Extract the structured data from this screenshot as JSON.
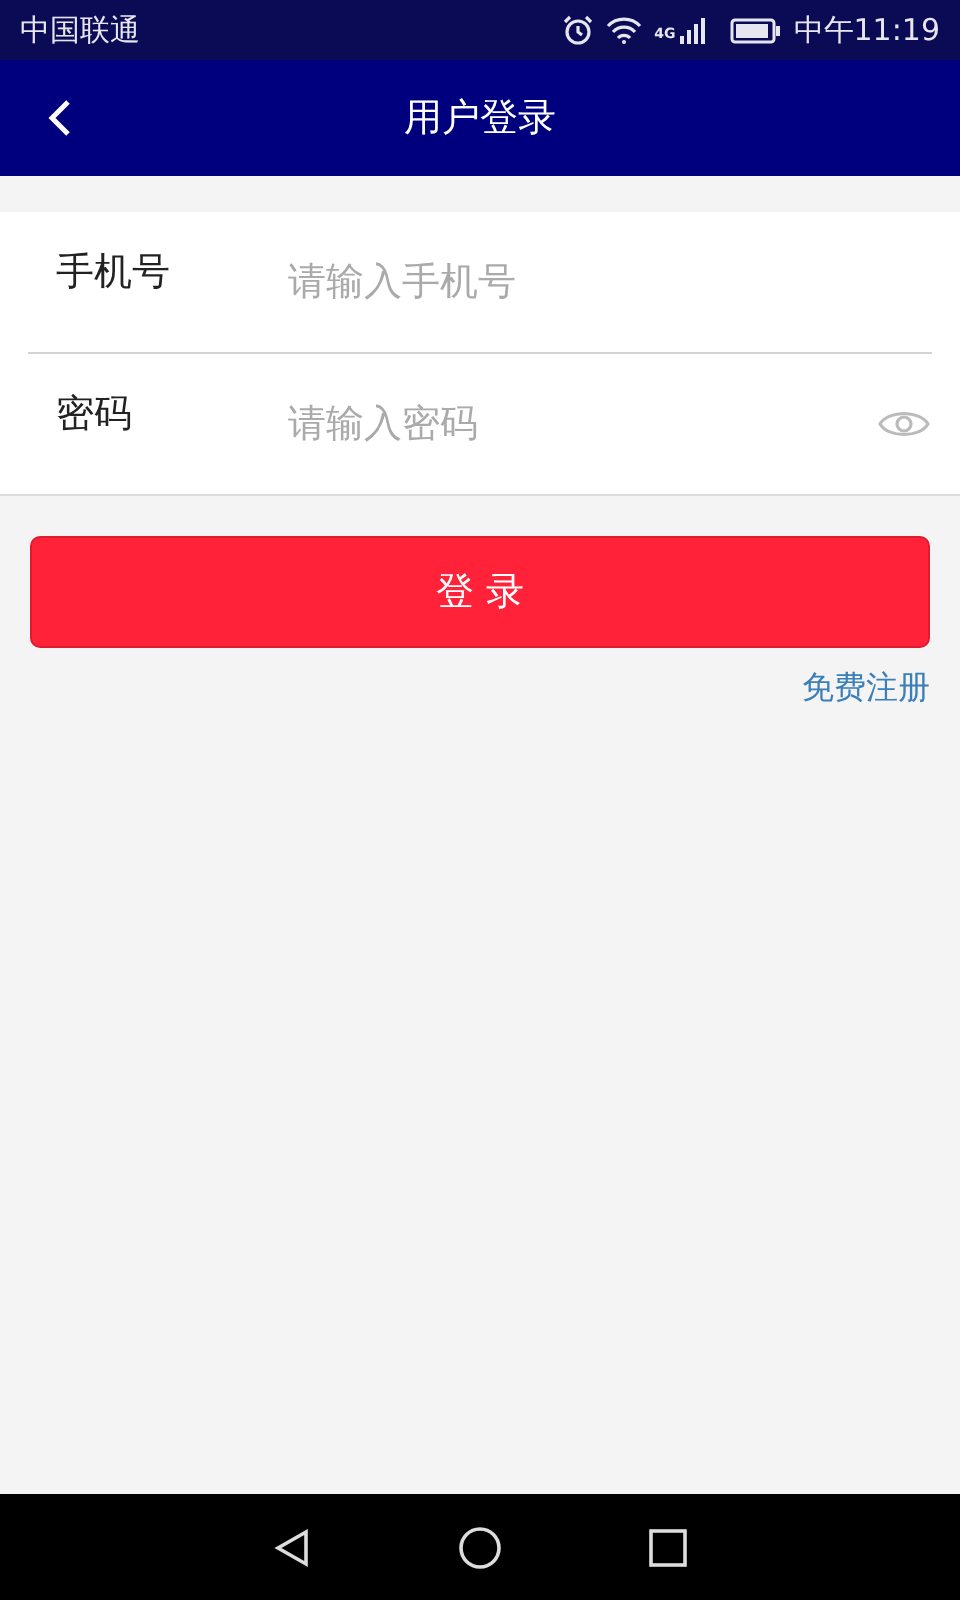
{
  "status_bar": {
    "carrier": "中国联通",
    "network": "4G",
    "time": "中午11:19"
  },
  "header": {
    "title": "用户登录"
  },
  "form": {
    "fields": [
      {
        "label": "手机号",
        "placeholder": "请输入手机号",
        "kind": "text"
      },
      {
        "label": "密码",
        "placeholder": "请输入密码",
        "kind": "password"
      }
    ]
  },
  "login_button": "登 录",
  "register_link": "免费注册"
}
